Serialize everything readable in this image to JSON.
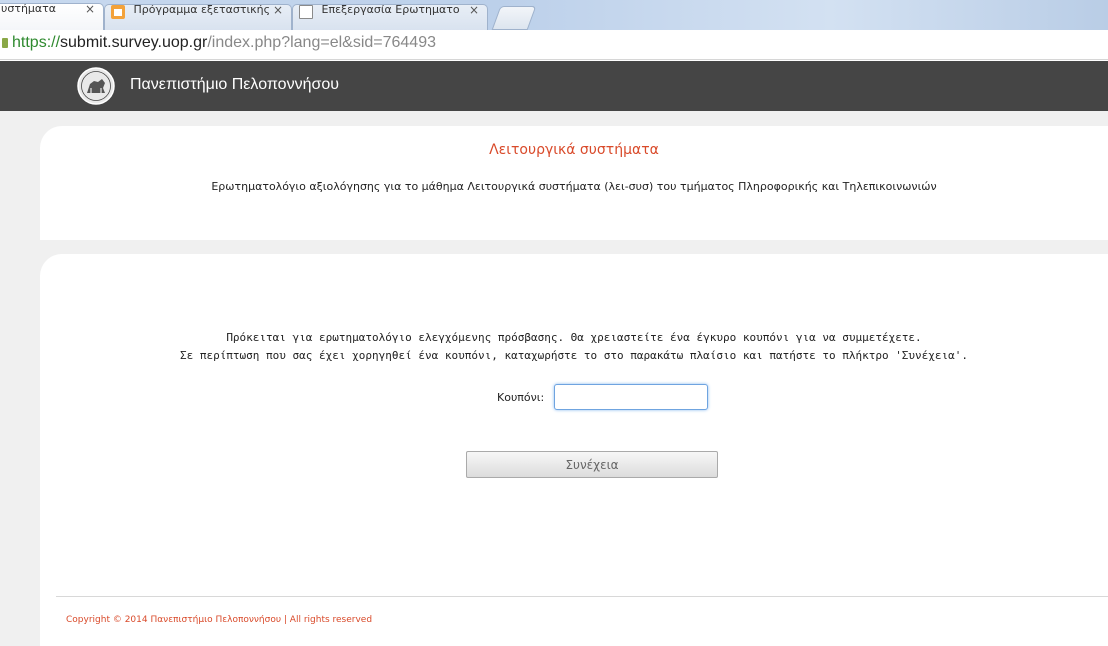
{
  "browser": {
    "tabs": [
      {
        "title": "υστήματα",
        "close": "×",
        "active": true,
        "favicon": "none"
      },
      {
        "title": "Πρόγραμμα εξεταστικής",
        "close": "×",
        "active": false,
        "favicon": "home-icon"
      },
      {
        "title": "Επεξεργασία Ερωτηματο",
        "close": "×",
        "active": false,
        "favicon": "page-icon"
      }
    ],
    "url": {
      "scheme": "https://",
      "host": "submit.survey.uop.gr",
      "path": "/index.php?lang=el&sid=764493"
    }
  },
  "header": {
    "title": "Πανεπιστήμιο Πελοποννήσου"
  },
  "survey": {
    "title": "Λειτουργικά συστήματα",
    "description": "Ερωτηματολόγιο αξιολόγησης για το μάθημα Λειτουργικά συστήματα (λει-συσ) του τμήματος Πληροφορικής και Τηλεπικοινωνιών"
  },
  "access": {
    "notice_line1": "Πρόκειται για ερωτηματολόγιο ελεγχόμενης πρόσβασης. Θα χρειαστείτε ένα έγκυρο κουπόνι για να συμμετέχετε.",
    "notice_line2": "Σε περίπτωση που σας έχει χορηγηθεί ένα κουπόνι, καταχωρήστε το στο παρακάτω πλαίσιο και πατήστε το πλήκτρο 'Συνέχεια'.",
    "coupon_label": "Κουπόνι:",
    "coupon_value": "",
    "continue_label": "Συνέχεια"
  },
  "footer": {
    "text": "Copyright © 2014 Πανεπιστήμιο Πελοποννήσου | All rights reserved"
  },
  "colors": {
    "accent": "#d94a2a",
    "header_bg": "#454545"
  }
}
